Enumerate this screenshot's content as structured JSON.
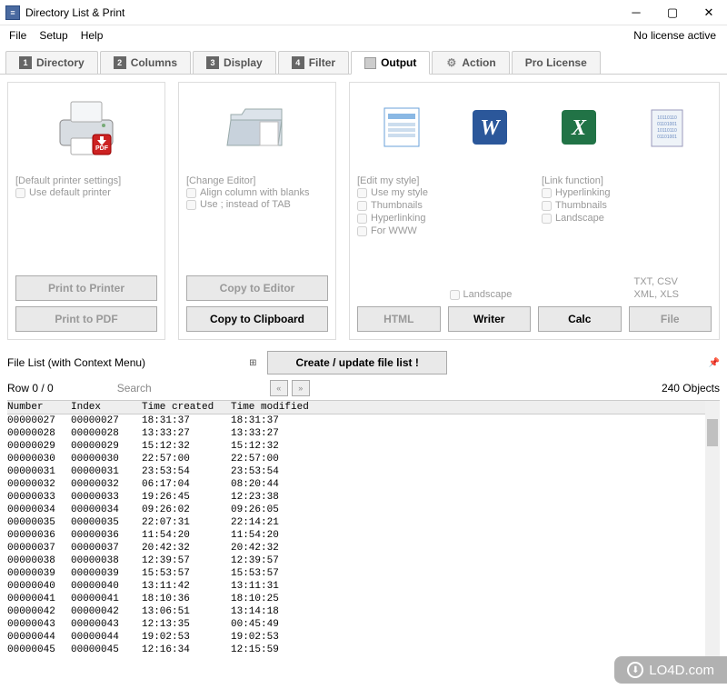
{
  "window": {
    "title": "Directory List & Print",
    "license_status": "No license active"
  },
  "menu": {
    "file": "File",
    "setup": "Setup",
    "help": "Help"
  },
  "tabs": [
    {
      "num": "1",
      "label": "Directory"
    },
    {
      "num": "2",
      "label": "Columns"
    },
    {
      "num": "3",
      "label": "Display"
    },
    {
      "num": "4",
      "label": "Filter"
    },
    {
      "icon": "doc",
      "label": "Output",
      "active": true
    },
    {
      "icon": "gear",
      "label": "Action"
    },
    {
      "label": "Pro License"
    }
  ],
  "panel_print": {
    "settings_hint": "[Default printer settings]",
    "use_default": "Use default printer",
    "btn_printer": "Print to Printer",
    "btn_pdf": "Print to PDF"
  },
  "panel_editor": {
    "change_hint": "[Change Editor]",
    "align": "Align column with blanks",
    "use_semi": "Use ; instead of TAB",
    "btn_editor": "Copy to Editor",
    "btn_clip": "Copy to Clipboard"
  },
  "panel_export": {
    "edit_hint": "[Edit my style]",
    "use_style": "Use my style",
    "thumbnails": "Thumbnails",
    "hyperlinking": "Hyperlinking",
    "for_www": "For WWW",
    "landscape": "Landscape",
    "link_hint": "[Link function]",
    "txt_csv": "TXT, CSV",
    "xml_xls": "XML, XLS",
    "btn_html": "HTML",
    "btn_writer": "Writer",
    "btn_calc": "Calc",
    "btn_file": "File"
  },
  "list_section": {
    "title": "File List (with Context Menu)",
    "create_btn": "Create / update file list !",
    "row_label": "Row 0 / 0",
    "search_label": "Search",
    "objects": "240 Objects"
  },
  "columns": {
    "number": "Number",
    "index": "Index",
    "time_created": "Time created",
    "time_modified": "Time modified"
  },
  "rows": [
    {
      "n": "00000027",
      "i": "00000027",
      "c": "18:31:37",
      "m": "18:31:37"
    },
    {
      "n": "00000028",
      "i": "00000028",
      "c": "13:33:27",
      "m": "13:33:27"
    },
    {
      "n": "00000029",
      "i": "00000029",
      "c": "15:12:32",
      "m": "15:12:32"
    },
    {
      "n": "00000030",
      "i": "00000030",
      "c": "22:57:00",
      "m": "22:57:00"
    },
    {
      "n": "00000031",
      "i": "00000031",
      "c": "23:53:54",
      "m": "23:53:54"
    },
    {
      "n": "00000032",
      "i": "00000032",
      "c": "06:17:04",
      "m": "08:20:44"
    },
    {
      "n": "00000033",
      "i": "00000033",
      "c": "19:26:45",
      "m": "12:23:38"
    },
    {
      "n": "00000034",
      "i": "00000034",
      "c": "09:26:02",
      "m": "09:26:05"
    },
    {
      "n": "00000035",
      "i": "00000035",
      "c": "22:07:31",
      "m": "22:14:21"
    },
    {
      "n": "00000036",
      "i": "00000036",
      "c": "11:54:20",
      "m": "11:54:20"
    },
    {
      "n": "00000037",
      "i": "00000037",
      "c": "20:42:32",
      "m": "20:42:32"
    },
    {
      "n": "00000038",
      "i": "00000038",
      "c": "12:39:57",
      "m": "12:39:57"
    },
    {
      "n": "00000039",
      "i": "00000039",
      "c": "15:53:57",
      "m": "15:53:57"
    },
    {
      "n": "00000040",
      "i": "00000040",
      "c": "13:11:42",
      "m": "13:11:31"
    },
    {
      "n": "00000041",
      "i": "00000041",
      "c": "18:10:36",
      "m": "18:10:25"
    },
    {
      "n": "00000042",
      "i": "00000042",
      "c": "13:06:51",
      "m": "13:14:18"
    },
    {
      "n": "00000043",
      "i": "00000043",
      "c": "12:13:35",
      "m": "00:45:49"
    },
    {
      "n": "00000044",
      "i": "00000044",
      "c": "19:02:53",
      "m": "19:02:53"
    },
    {
      "n": "00000045",
      "i": "00000045",
      "c": "12:16:34",
      "m": "12:15:59"
    }
  ],
  "watermark": "LO4D.com"
}
